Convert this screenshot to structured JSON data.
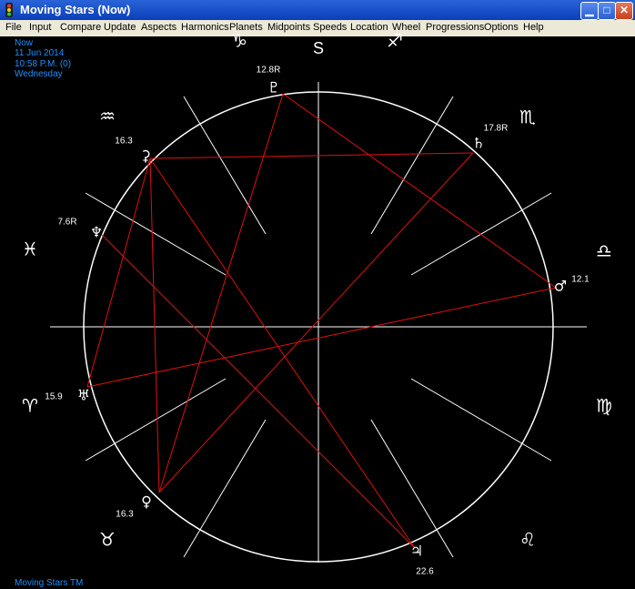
{
  "window": {
    "title": "Moving Stars (Now)",
    "buttons": {
      "minimize": "▁",
      "maximize": "□",
      "close": "✕"
    }
  },
  "menu": [
    "File",
    "Input",
    "Compare",
    "Update",
    "Aspects",
    "Harmonics",
    "Planets",
    "Midpoints",
    "Speeds",
    "Location",
    "Wheel",
    "Progressions",
    "Options",
    "Help"
  ],
  "info": {
    "line1": "Now",
    "line2": "11 Jun 2014",
    "line3": "10:58 P.M. (0)",
    "line4": "Wednesday"
  },
  "footer": "Moving Stars TM",
  "wheel": {
    "top_label": "S"
  },
  "signs": [
    {
      "name": "capricorn",
      "glyph": "♑"
    },
    {
      "name": "sagittarius",
      "glyph": "♐"
    },
    {
      "name": "scorpio",
      "glyph": "♏"
    },
    {
      "name": "libra",
      "glyph": "♎"
    },
    {
      "name": "virgo",
      "glyph": "♍"
    },
    {
      "name": "leo",
      "glyph": "♌"
    },
    {
      "name": "taurus",
      "glyph": "♉"
    },
    {
      "name": "aries",
      "glyph": "♈"
    },
    {
      "name": "pisces",
      "glyph": "♓"
    },
    {
      "name": "aquarius",
      "glyph": "♒"
    }
  ],
  "planets": [
    {
      "name": "pluto",
      "glyph": "♇",
      "degree": "12.8R"
    },
    {
      "name": "saturn",
      "glyph": "♄",
      "degree": "17.8R"
    },
    {
      "name": "mars",
      "glyph": "♂",
      "degree": "12.1"
    },
    {
      "name": "jupiter",
      "glyph": "♃",
      "degree": "22.6"
    },
    {
      "name": "venus",
      "glyph": "♀",
      "degree": "16.3"
    },
    {
      "name": "uranus",
      "glyph": "♅",
      "degree": "15.9"
    },
    {
      "name": "neptune",
      "glyph": "♆",
      "degree": "7.6R"
    },
    {
      "name": "ceres",
      "glyph": "⚳",
      "degree": "16.3"
    }
  ],
  "colors": {
    "aspect": "#e01010",
    "info_text": "#1e90ff",
    "wheel": "#ffffff",
    "background": "#000000"
  }
}
